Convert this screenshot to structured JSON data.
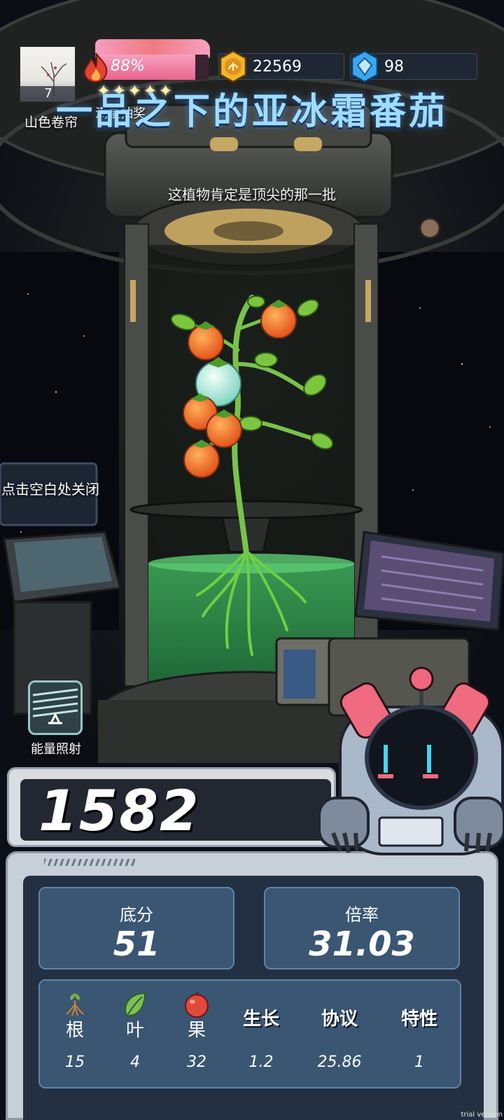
{
  "player": {
    "avatar_level": "7",
    "nickname": "山色卷帘"
  },
  "energy": {
    "percent_text": "88%",
    "fill_fraction": 0.88
  },
  "lottery": {
    "stars": "✦✦✦✦✦",
    "label": "满星抽奖"
  },
  "currency": {
    "coins": "22569",
    "gems": "98"
  },
  "plant": {
    "title": "一品之下的亚冰霜番茄",
    "subtitle": "这植物肯定是顶尖的那一批"
  },
  "hint": {
    "close": "点击空白处关闭"
  },
  "action": {
    "energy_button_label": "能量照射"
  },
  "score": {
    "total": "1582"
  },
  "stats": {
    "base_label": "底分",
    "base_value": "51",
    "multiplier_label": "倍率",
    "multiplier_value": "31.03"
  },
  "attributes": [
    {
      "label": "根",
      "value": "15",
      "icon": "root-icon"
    },
    {
      "label": "叶",
      "value": "4",
      "icon": "leaf-icon"
    },
    {
      "label": "果",
      "value": "32",
      "icon": "fruit-icon"
    },
    {
      "label": "生长",
      "value": "1.2"
    },
    {
      "label": "协议",
      "value": "25.86"
    },
    {
      "label": "特性",
      "value": "1"
    }
  ],
  "colors": {
    "accent_title": "#9fdcff",
    "energy_fill": "#e8658f",
    "panel_card": "#3a5673",
    "panel_bg": "#233042"
  },
  "watermark": "trial version"
}
